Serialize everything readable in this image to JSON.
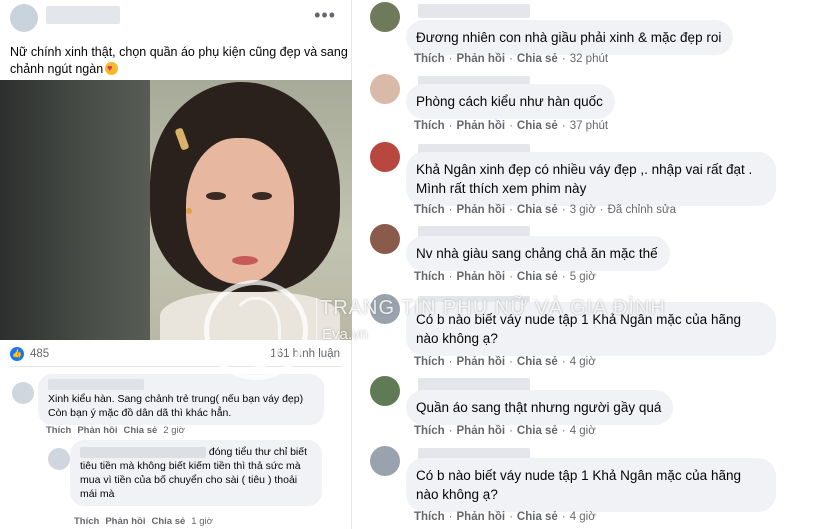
{
  "post": {
    "caption": "Nữ chính xinh thật, chọn quần áo phụ kiện cũng đẹp và sang chảnh ngút ngàn",
    "more_label": "•••",
    "like_count": "485",
    "comment_count": "161 bình luận"
  },
  "small_comments": [
    {
      "text": "Xinh kiểu hàn. Sang chảnh trẻ trung( nếu bạn váy đẹp) Còn bạn ý mặc đồ dân dã thì khác hẳn.",
      "actions": {
        "like": "Thích",
        "reply": "Phản hồi",
        "share": "Chia sẻ",
        "time": "2 giờ"
      }
    },
    {
      "text_part1": "đóng tiểu thư chỉ biết",
      "text_part2": "tiêu tiền mà không biết kiếm tiền thì thả sức mà mua vì tiền của bố chuyển cho sài ( tiêu ) thoải mái mà",
      "actions": {
        "like": "Thích",
        "reply": "Phản hồi",
        "share": "Chia sẻ",
        "time": "1 giờ"
      }
    }
  ],
  "comments": [
    {
      "text": "Đương nhiên con nhà giầu phải xinh & mặc đẹp roi",
      "like": "Thích",
      "reply": "Phản hồi",
      "share": "Chia sẻ",
      "time": "32 phút",
      "extra": "",
      "avatar_color": "#6f7a5b"
    },
    {
      "text": "Phòng cách kiểu như hàn quốc",
      "like": "Thích",
      "reply": "Phản hồi",
      "share": "Chia sẻ",
      "time": "37 phút",
      "extra": "",
      "avatar_color": "#d9b9a8"
    },
    {
      "text": "Khả Ngân xinh đẹp có nhiều váy đẹp ,. nhập vai rất đạt . Mình rất thích xem phim này",
      "like": "Thích",
      "reply": "Phản hồi",
      "share": "Chia sẻ",
      "time": "3 giờ",
      "extra": "Đã chỉnh sửa",
      "avatar_color": "#b8473f"
    },
    {
      "text": "Nv nhà giàu sang chảng chả ăn mặc thế",
      "like": "Thích",
      "reply": "Phản hồi",
      "share": "Chia sẻ",
      "time": "5 giờ",
      "extra": "",
      "avatar_color": "#8a5a4a"
    },
    {
      "text": "Có b nào biết váy nude tập 1 Khả Ngân mặc của hãng nào không ạ?",
      "like": "Thích",
      "reply": "Phản hồi",
      "share": "Chia sẻ",
      "time": "4 giờ",
      "extra": "",
      "avatar_color": "#9aa3ad"
    },
    {
      "text": "Quần áo sang thật nhưng người gầy quá",
      "like": "Thích",
      "reply": "Phản hồi",
      "share": "Chia sẻ",
      "time": "4 giờ",
      "extra": "",
      "avatar_color": "#5f7b56"
    },
    {
      "text": "Có b nào biết váy nude tập 1 Khả Ngân mặc của hãng nào không ạ?",
      "like": "Thích",
      "reply": "Phản hồi",
      "share": "Chia sẻ",
      "time": "4 giờ",
      "extra": "",
      "avatar_color": "#9aa3ad"
    }
  ],
  "watermark": {
    "title": "TRANG TIN PHỤ NỮ VÀ GIA ĐÌNH",
    "site": "Eva.vn"
  }
}
